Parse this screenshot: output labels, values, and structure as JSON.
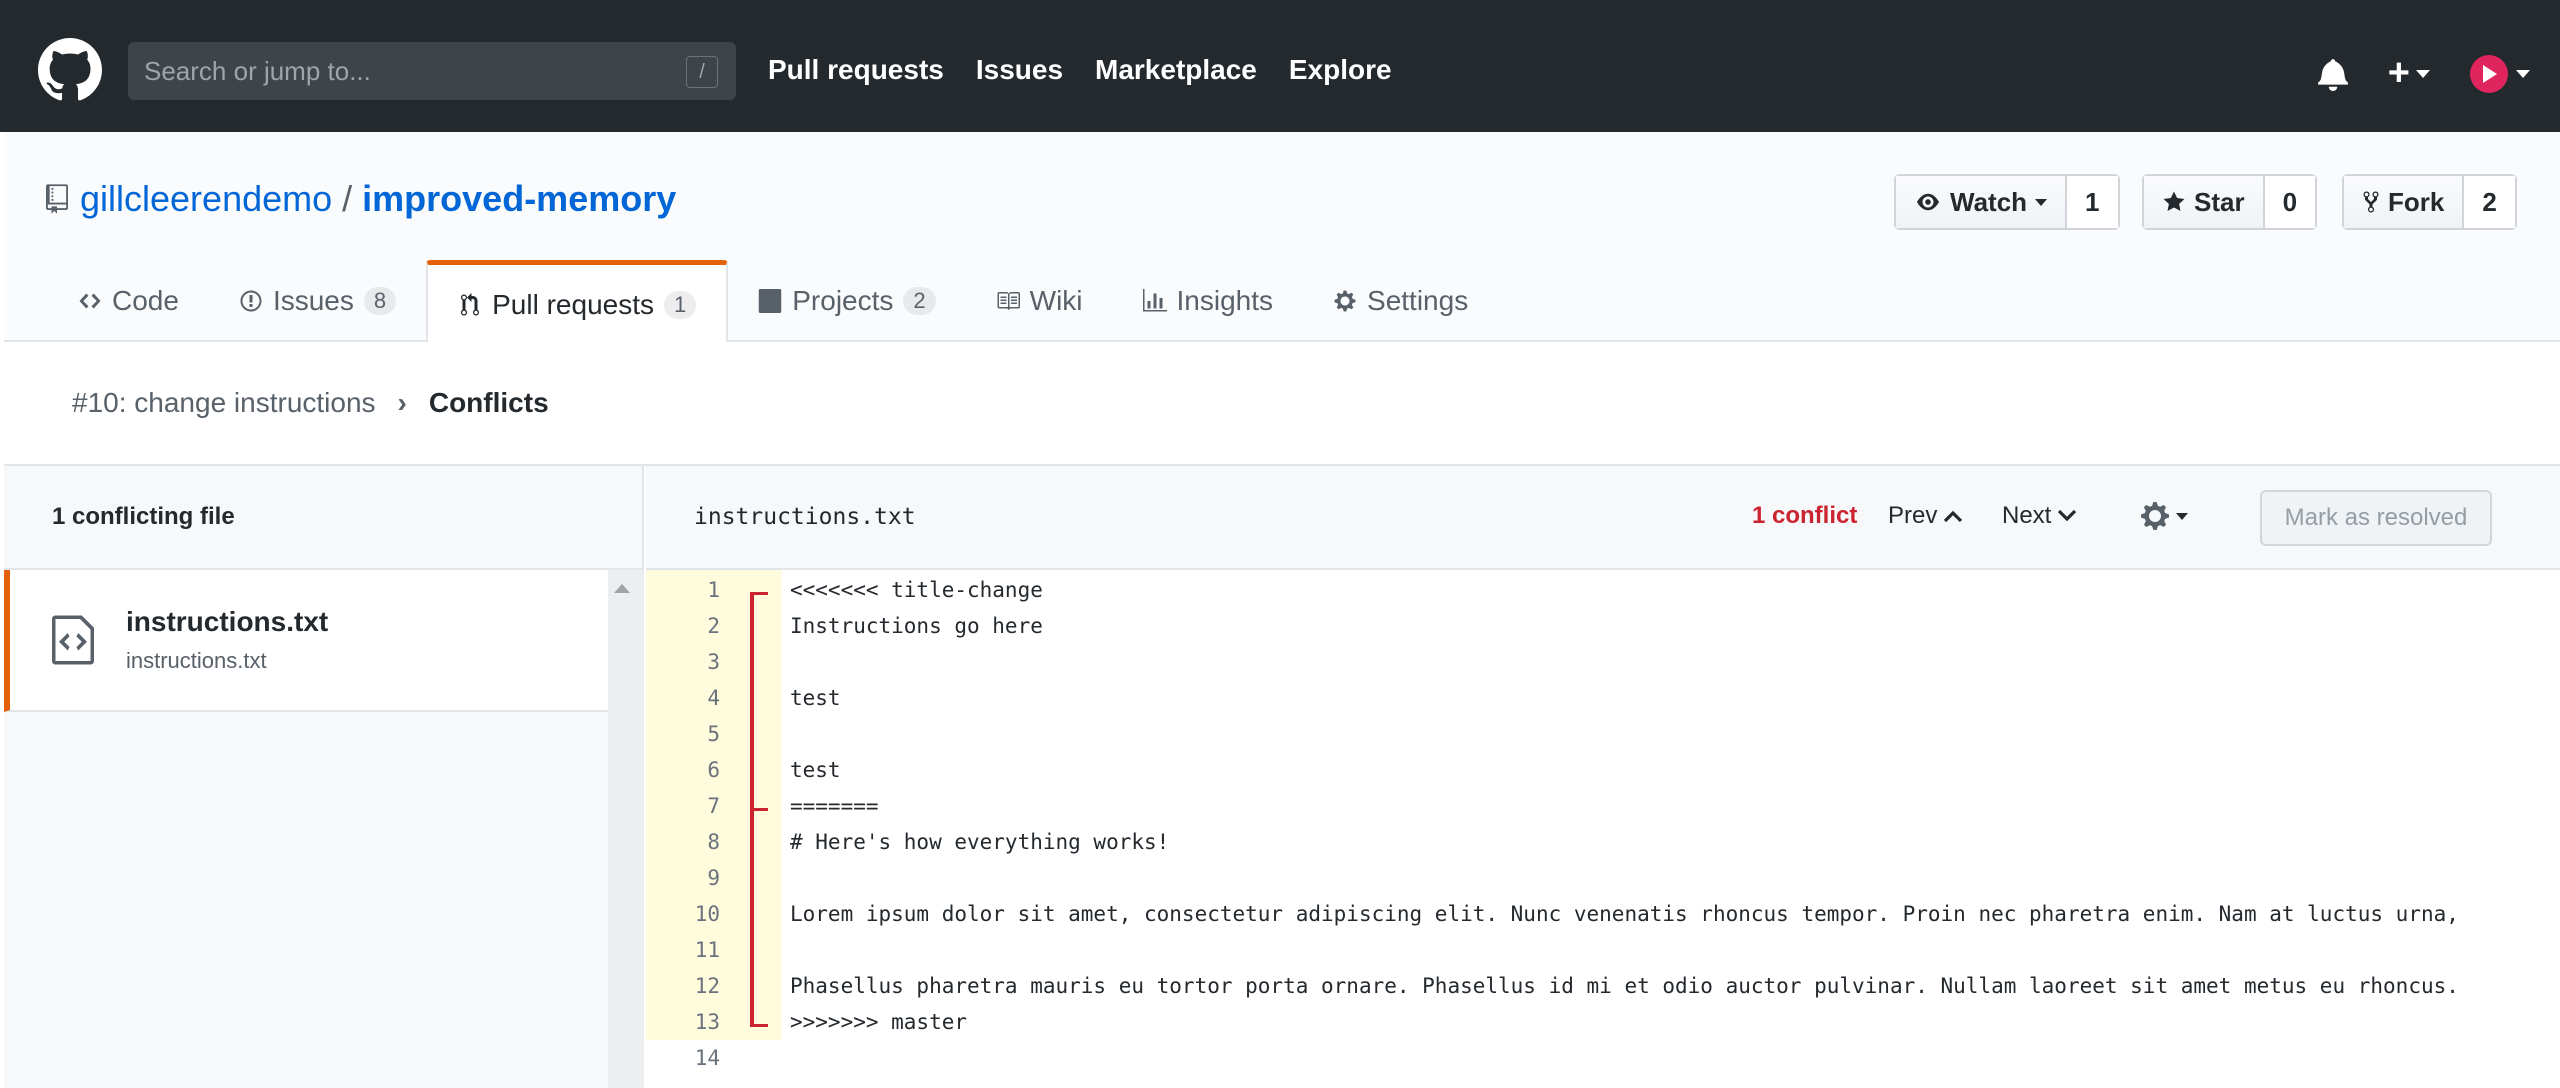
{
  "header": {
    "search_placeholder": "Search or jump to...",
    "slash_key": "/",
    "nav": [
      "Pull requests",
      "Issues",
      "Marketplace",
      "Explore"
    ]
  },
  "repo": {
    "owner": "gillcleerendemo",
    "separator": "/",
    "name": "improved-memory",
    "watch_label": "Watch",
    "watch_count": "1",
    "star_label": "Star",
    "star_count": "0",
    "fork_label": "Fork",
    "fork_count": "2"
  },
  "tabs": [
    {
      "label": "Code",
      "counter": null
    },
    {
      "label": "Issues",
      "counter": "8"
    },
    {
      "label": "Pull requests",
      "counter": "1"
    },
    {
      "label": "Projects",
      "counter": "2"
    },
    {
      "label": "Wiki",
      "counter": null
    },
    {
      "label": "Insights",
      "counter": null
    },
    {
      "label": "Settings",
      "counter": null
    }
  ],
  "breadcrumb": {
    "pr": "#10: change instructions",
    "current": "Conflicts"
  },
  "files": {
    "heading": "1 conflicting file",
    "items": [
      {
        "name": "instructions.txt",
        "path": "instructions.txt"
      }
    ]
  },
  "editor": {
    "filename": "instructions.txt",
    "conflict_count": "1 conflict",
    "prev_label": "Prev",
    "next_label": "Next",
    "resolve_label": "Mark as resolved",
    "lines": [
      {
        "n": "1",
        "text": "<<<<<<< title-change"
      },
      {
        "n": "2",
        "text": "Instructions go here"
      },
      {
        "n": "3",
        "text": ""
      },
      {
        "n": "4",
        "text": "test"
      },
      {
        "n": "5",
        "text": ""
      },
      {
        "n": "6",
        "text": "test"
      },
      {
        "n": "7",
        "text": "======="
      },
      {
        "n": "8",
        "text": "# Here's how everything works!"
      },
      {
        "n": "9",
        "text": ""
      },
      {
        "n": "10",
        "text": "Lorem ipsum dolor sit amet, consectetur adipiscing elit. Nunc venenatis rhoncus tempor. Proin nec pharetra enim. Nam at luctus urna,"
      },
      {
        "n": "11",
        "text": ""
      },
      {
        "n": "12",
        "text": "Phasellus pharetra mauris eu tortor porta ornare. Phasellus id mi et odio auctor pulvinar. Nullam laoreet sit amet metus eu rhoncus."
      },
      {
        "n": "13",
        "text": ">>>>>>> master"
      },
      {
        "n": "14",
        "text": ""
      }
    ]
  },
  "colors": {
    "header_bg": "#24292e",
    "link": "#0366d6",
    "accent_orange": "#e36209",
    "conflict_red": "#cb2431",
    "gutter_yellow": "#fffbdd"
  },
  "icons": {
    "logo": "github-logo-icon",
    "bell": "bell-icon",
    "plus": "plus-icon",
    "repo": "repo-icon",
    "eye": "eye-icon",
    "star": "star-icon",
    "fork": "fork-icon",
    "gear": "gear-icon",
    "file_code": "file-code-icon"
  }
}
